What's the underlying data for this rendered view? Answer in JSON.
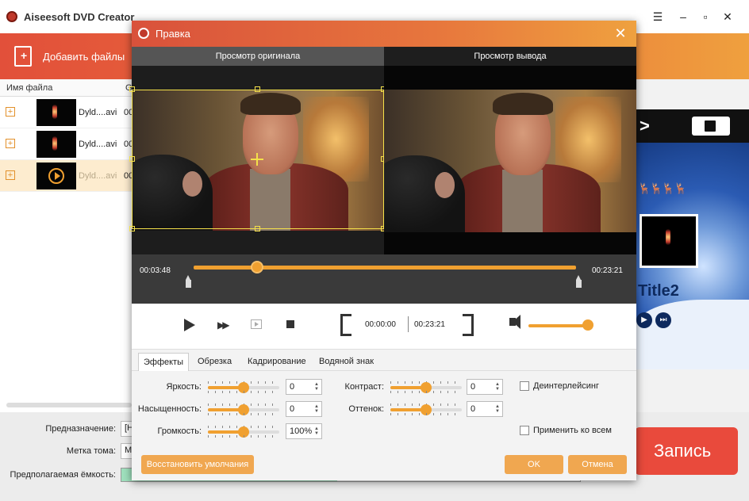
{
  "app": {
    "title": "Aiseesoft DVD Creator",
    "toolbar": {
      "add_files_label": "Добавить файлы"
    },
    "file_list": {
      "col_name": "Имя файла",
      "col_second": "G",
      "rows": [
        {
          "name": "Dyld....avi",
          "dur": "00"
        },
        {
          "name": "Dyld....avi",
          "dur": "00"
        },
        {
          "name": "Dyld....avi",
          "dur": "00"
        }
      ]
    },
    "bottom": {
      "destination_label": "Предназначение:",
      "destination_value": "[H",
      "volume_label_label": "Метка тома:",
      "volume_label_value": "M",
      "capacity_label": "Предполагаемая ёмкость:",
      "capacity_fraction": 0.47
    },
    "record_label": "Запись",
    "preview_title": "Title2"
  },
  "dialog": {
    "title": "Правка",
    "pane_original_label": "Просмотр оригинала",
    "pane_output_label": "Просмотр вывода",
    "timeline": {
      "start": "00:03:48",
      "end": "00:23:21",
      "progress": 0.165
    },
    "controls": {
      "cut_start": "00:00:00",
      "cut_end": "00:23:21",
      "volume": 1.0
    },
    "tabs": [
      "Эффекты",
      "Обрезка",
      "Кадрирование",
      "Водяной знак"
    ],
    "active_tab": 0,
    "effects": {
      "brightness_label": "Яркость:",
      "brightness_value": "0",
      "saturation_label": "Насыщенность:",
      "saturation_value": "0",
      "volume_label": "Громкость:",
      "volume_value": "100%",
      "contrast_label": "Контраст:",
      "contrast_value": "0",
      "hue_label": "Оттенок:",
      "hue_value": "0",
      "deinterlace_label": "Деинтерлейсинг",
      "apply_all_label": "Применить ко всем"
    },
    "footer": {
      "restore_label": "Восстановить умолчания",
      "ok_label": "OK",
      "cancel_label": "Отмена"
    }
  },
  "colors": {
    "accent": "#f0a030",
    "header_gradient_start": "#d9513b",
    "header_gradient_end": "#efa13f",
    "record_button": "#e94a3c"
  }
}
